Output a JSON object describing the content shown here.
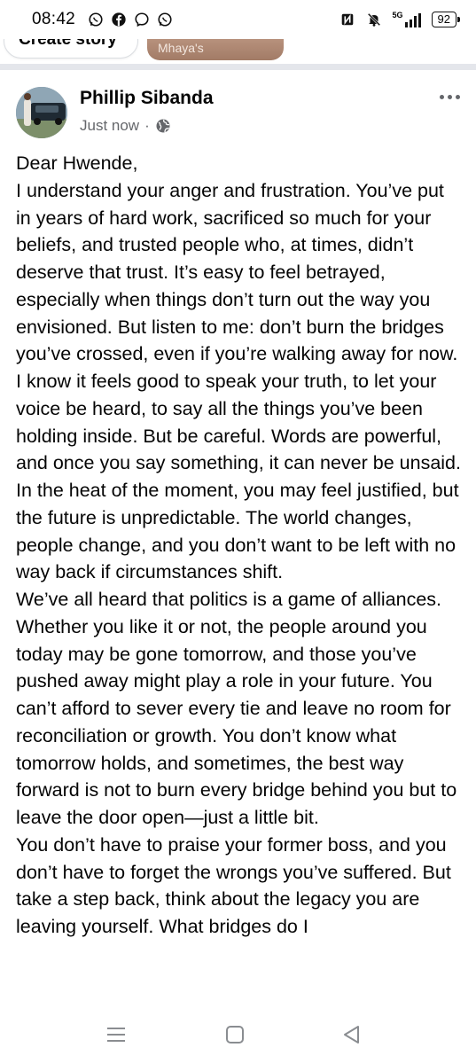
{
  "status_bar": {
    "time": "08:42",
    "battery": "92",
    "network": "5G",
    "left_icons": [
      "whatsapp-icon",
      "facebook-icon",
      "messenger-icon",
      "whatsapp-icon"
    ],
    "right_icons": [
      "nfc-icon",
      "mute-icon",
      "signal-icon",
      "battery-icon"
    ]
  },
  "stories": {
    "create_label": "Create story",
    "thumb_label": "Mhaya's"
  },
  "post": {
    "author": "Phillip Sibanda",
    "time": "Just now",
    "separator": "·",
    "privacy_icon": "globe-icon",
    "more_icon": "more-options-icon",
    "paragraphs": [
      "Dear Hwende,",
      "I understand your anger and frustration. You’ve put in years of hard work, sacrificed so much for your beliefs, and trusted people who, at times, didn’t deserve that trust. It’s easy to feel betrayed, especially when things don’t turn out the way you envisioned. But listen to me: don’t burn the bridges you’ve crossed, even if you’re walking away for now.",
      "I know it feels good to speak your truth, to let your voice be heard, to say all the things you’ve been holding inside. But be careful. Words are powerful, and once you say something, it can never be unsaid. In the heat of the moment, you may feel justified, but the future is unpredictable. The world changes, people change, and you don’t want to be left with no way back if circumstances shift.",
      "We’ve all heard that politics is a game of alliances. Whether you like it or not, the people around you today may be gone tomorrow, and those you’ve pushed away might play a role in your future. You can’t afford to sever every tie and leave no room for reconciliation or growth. You don’t know what tomorrow holds, and sometimes, the best way forward is not to burn every bridge behind you but to leave the door open—just a little bit.",
      "You don’t have to praise your former boss, and you don’t have to forget the wrongs you’ve suffered. But take a step back, think about the legacy you are leaving yourself. What bridges do I"
    ]
  },
  "nav_bar": {
    "buttons": [
      "recent-apps-icon",
      "home-icon",
      "back-icon"
    ]
  },
  "colors": {
    "text": "#050505",
    "secondary_text": "#65676b",
    "divider": "#e4e6eb",
    "nav_icon": "#8a8d91"
  }
}
